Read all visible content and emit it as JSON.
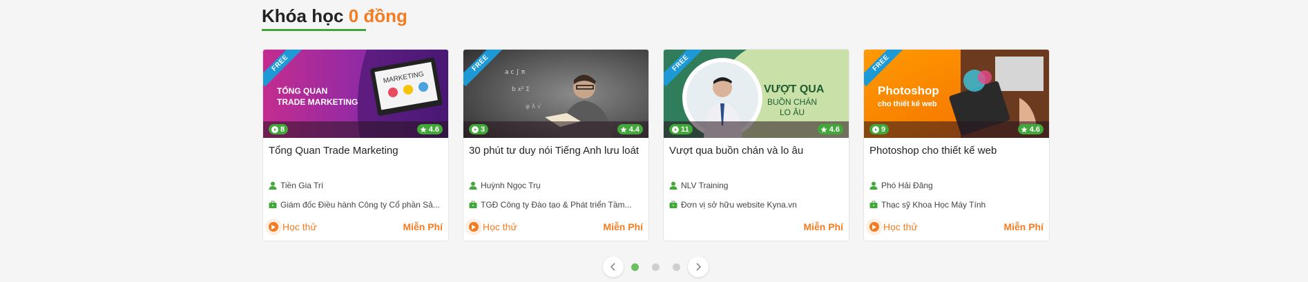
{
  "section": {
    "title_prefix": "Khóa học",
    "title_accent": "0 đồng"
  },
  "cards": [
    {
      "ribbon": "FREE",
      "thumb_text": [
        "TỔNG QUAN",
        "TRADE MARKETING"
      ],
      "lessons": "8",
      "rating": "4.6",
      "title": "Tổng Quan Trade Marketing",
      "author": "Tiền Gia Trí",
      "job": "Giám đốc Điều hành Công ty Cổ phần Sả...",
      "trial": "Học thử",
      "price": "Miễn Phí"
    },
    {
      "ribbon": "FREE",
      "lessons": "3",
      "rating": "4.4",
      "title": "30 phút tư duy nói Tiếng Anh lưu loát",
      "author": "Huỳnh Ngọc Trụ",
      "job": "TGĐ Công ty Đào tạo & Phát triển Tầm...",
      "trial": "Học thử",
      "price": "Miễn Phí"
    },
    {
      "ribbon": "FREE",
      "thumb_text": [
        "VƯỢT QUA",
        "BUỒN CHÁN",
        "LO ÂU"
      ],
      "lessons": "11",
      "rating": "4.6",
      "title": "Vượt qua buồn chán và lo âu",
      "author": "NLV Training",
      "job": "Đơn vị sở hữu website Kyna.vn",
      "trial": "",
      "price": "Miễn Phí"
    },
    {
      "ribbon": "FREE",
      "thumb_text": [
        "Photoshop",
        "cho thiết kế web"
      ],
      "lessons": "9",
      "rating": "4.6",
      "title": "Photoshop cho thiết kế web",
      "author": "Phó Hải Đăng",
      "job": "Thạc sỹ Khoa Học Máy Tính",
      "trial": "Học thử",
      "price": "Miễn Phí"
    }
  ],
  "pagination": {
    "dots": 3,
    "active_index": 0
  },
  "colors": {
    "accent": "#f47c20",
    "green": "#43a83a",
    "ribbon": "#1d9ad6"
  },
  "icons": {
    "lessons": "play-circle-icon",
    "rating": "star-icon",
    "author": "user-icon",
    "job": "briefcase-icon",
    "prev": "chevron-left-icon",
    "next": "chevron-right-icon"
  }
}
